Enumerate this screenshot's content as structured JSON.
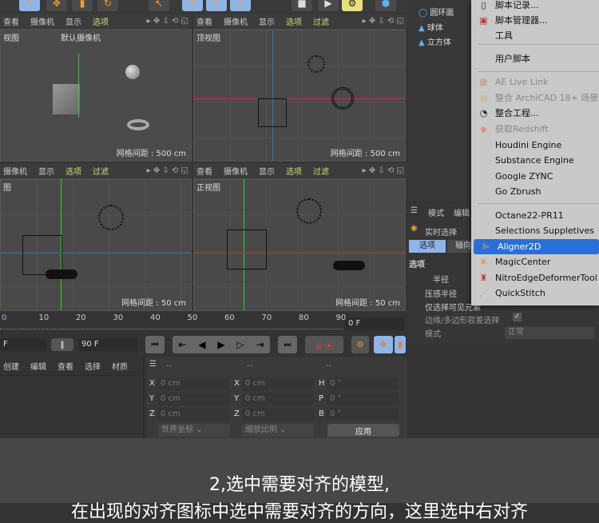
{
  "viewport_menu": {
    "view": "查看",
    "camera": "摄像机",
    "display": "显示",
    "options": "选项",
    "filter": "过滤"
  },
  "viewports": [
    {
      "title": "视图",
      "camera": "默认摄像机",
      "grid": "网格间距 : 500 cm"
    },
    {
      "title": "顶视图",
      "grid": "网格间距 : 500 cm"
    },
    {
      "title": "图",
      "grid": "网格间距 : 50 cm"
    },
    {
      "title": "正视图",
      "grid": "网格间距 : 50 cm"
    }
  ],
  "objects": [
    "圆环面",
    "球体",
    "立方体"
  ],
  "menu": {
    "items": [
      {
        "label": "脚本记录...",
        "icon": "script-log-icon"
      },
      {
        "label": "脚本管理器...",
        "icon": "script-manager-icon"
      },
      {
        "label": "工具"
      },
      {
        "label": "用户脚本"
      },
      {
        "label": "AE Live Link",
        "icon": "ae-icon",
        "disabled": true
      },
      {
        "label": "整合 ArchiCAD 18+ 场景...",
        "icon": "archicad-icon",
        "disabled": true
      },
      {
        "label": "整合工程...",
        "icon": "merge-project-icon"
      },
      {
        "label": "获取Redshift",
        "icon": "redshift-icon",
        "disabled": true
      },
      {
        "label": "Houdini Engine"
      },
      {
        "label": "Substance Engine"
      },
      {
        "label": "Google ZYNC"
      },
      {
        "label": "Go Zbrush"
      },
      {
        "label": "Octane22-PR11"
      },
      {
        "label": "Selections Suppletives"
      },
      {
        "label": "Aligner2D",
        "icon": "aligner2d-icon",
        "selected": true
      },
      {
        "label": "MagicCenter",
        "icon": "magic-center-icon"
      },
      {
        "label": "NitroEdgeDeformerTool",
        "icon": "nitro-edge-icon"
      },
      {
        "label": "QuickStitch",
        "icon": "quick-stitch-icon"
      }
    ]
  },
  "attributes": {
    "mode": "模式",
    "edit": "编辑",
    "tool": "实时选择",
    "tab_options": "选项",
    "tab_axis": "轴向",
    "section": "选项",
    "radius": "半径",
    "pressure_radius": "压感半径",
    "visible_only": "仅选择可见元素",
    "edge_tolerance": "边缘/多边形容差选择",
    "mode_label": "模式",
    "mode_value": "正常"
  },
  "timeline": {
    "ticks": [
      "0",
      "10",
      "20",
      "30",
      "40",
      "50",
      "60",
      "70",
      "80",
      "90"
    ],
    "current_frame": "0 F",
    "start": "F",
    "end": "90 F"
  },
  "materials_menu": [
    "创建",
    "编辑",
    "查看",
    "选择",
    "材质"
  ],
  "coords": {
    "headers": [
      "--",
      "--",
      "--"
    ],
    "rows": [
      [
        "X",
        "0 cm",
        "X",
        "0 cm",
        "H",
        "0 °"
      ],
      [
        "Y",
        "0 cm",
        "Y",
        "0 cm",
        "P",
        "0 °"
      ],
      [
        "Z",
        "0 cm",
        "Z",
        "0 cm",
        "B",
        "0 °"
      ]
    ],
    "world": "世界坐标",
    "scale": "缩放比例",
    "apply": "应用"
  },
  "caption": {
    "line1": "2,选中需要对齐的模型,",
    "line2": "在出现的对齐图标中选中需要对齐的方向，这里选中右对齐"
  }
}
